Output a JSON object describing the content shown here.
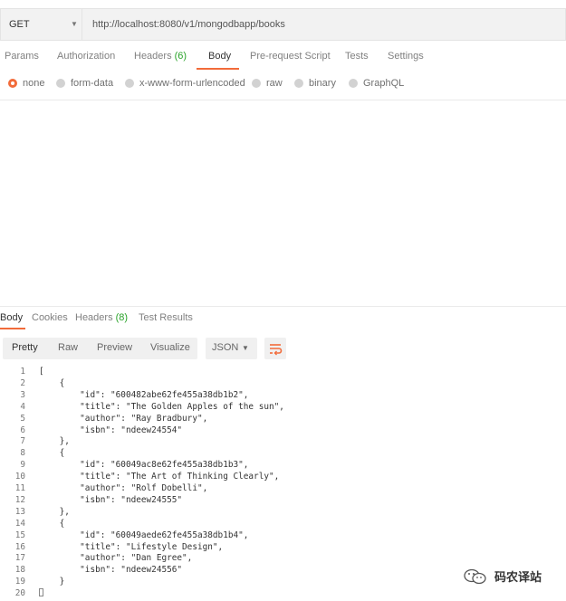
{
  "request": {
    "method": "GET",
    "url": "http://localhost:8080/v1/mongodbapp/books"
  },
  "request_tabs": [
    {
      "label": "Params"
    },
    {
      "label": "Authorization"
    },
    {
      "label": "Headers",
      "count": "(6)"
    },
    {
      "label": "Body",
      "active": true
    },
    {
      "label": "Pre-request Script"
    },
    {
      "label": "Tests"
    },
    {
      "label": "Settings"
    }
  ],
  "body_types": [
    {
      "label": "none",
      "selected": true
    },
    {
      "label": "form-data"
    },
    {
      "label": "x-www-form-urlencoded"
    },
    {
      "label": "raw"
    },
    {
      "label": "binary"
    },
    {
      "label": "GraphQL"
    }
  ],
  "response_tabs": [
    {
      "label": "Body",
      "active": true
    },
    {
      "label": "Cookies"
    },
    {
      "label": "Headers",
      "count": "(8)"
    },
    {
      "label": "Test Results"
    }
  ],
  "view_modes": [
    "Pretty",
    "Raw",
    "Preview",
    "Visualize"
  ],
  "format": "JSON",
  "accent_color": "#f26b3a",
  "count_color": "#29a329",
  "code_lines": [
    "[",
    "    {",
    "        \"id\": \"600482abe62fe455a38db1b2\",",
    "        \"title\": \"The Golden Apples of the sun\",",
    "        \"author\": \"Ray Bradbury\",",
    "        \"isbn\": \"ndeew24554\"",
    "    },",
    "    {",
    "        \"id\": \"60049ac8e62fe455a38db1b3\",",
    "        \"title\": \"The Art of Thinking Clearly\",",
    "        \"author\": \"Rolf Dobelli\",",
    "        \"isbn\": \"ndeew24555\"",
    "    },",
    "    {",
    "        \"id\": \"60049aede62fe455a38db1b4\",",
    "        \"title\": \"Lifestyle Design\",",
    "        \"author\": \"Dan Egree\",",
    "        \"isbn\": \"ndeew24556\"",
    "    }",
    "]"
  ],
  "line_numbers": [
    "1",
    "2",
    "3",
    "4",
    "5",
    "6",
    "7",
    "8",
    "9",
    "10",
    "11",
    "12",
    "13",
    "14",
    "15",
    "16",
    "17",
    "18",
    "19",
    "20"
  ],
  "watermark": "码农译站"
}
